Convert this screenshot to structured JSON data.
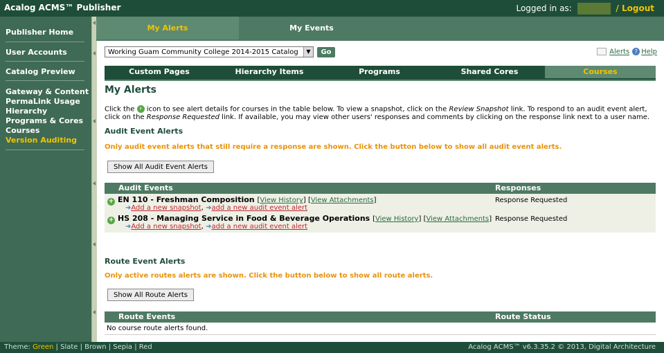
{
  "app": {
    "title": "Acalog ACMS™ Publisher",
    "logged_in_label": "Logged in as:",
    "logout_label": "/ Logout"
  },
  "sidebar": {
    "main": [
      "Publisher Home",
      "User Accounts",
      "Catalog Preview"
    ],
    "links": [
      "Gateway & Content",
      "PermaLink Usage",
      "Hierarchy",
      "Programs & Cores",
      "Courses",
      "Version Auditing"
    ],
    "active_link": "Version Auditing"
  },
  "top_tabs": [
    "My Alerts",
    "My Events"
  ],
  "catalog_select": {
    "value": "Working Guam Community College 2014-2015 Catalog",
    "go_label": "Go"
  },
  "top_links": {
    "alerts": "Alerts",
    "help": "Help"
  },
  "nav_tabs": [
    "Custom Pages",
    "Hierarchy Items",
    "Programs",
    "Shared Cores",
    "Courses"
  ],
  "page": {
    "title": "My Alerts",
    "desc": {
      "p1": "Click the ",
      "p2": " icon to see alert details for courses in the table below. To view a snapshot, click on the ",
      "p3": "Review Snapshot",
      "p4": " link. To respond to an audit event alert, click on the ",
      "p5": "Response Requested",
      "p6": " link. If available, you may view other users' responses and comments by clicking on the response link next to a user name."
    }
  },
  "audit": {
    "heading": "Audit Event Alerts",
    "notice": "Only audit event alerts that still require a response are shown. Click the button below to show all audit event alerts.",
    "button": "Show All Audit Event Alerts",
    "col_events": "Audit Events",
    "col_responses": "Responses",
    "rows": [
      {
        "course": "EN 110 - Freshman Composition",
        "view_history": "View History",
        "view_attachments": "View Attachments",
        "add_snapshot": "Add a new snapshot",
        "add_alert": "add a new audit event alert",
        "response": "Response Requested"
      },
      {
        "course": "HS 208 - Managing Service in Food & Beverage Operations",
        "view_history": "View History",
        "view_attachments": "View Attachments",
        "add_snapshot": "Add a new snapshot",
        "add_alert": "add a new audit event alert",
        "response": "Response Requested"
      }
    ]
  },
  "route": {
    "heading": "Route Event Alerts",
    "notice": "Only active routes alerts are shown. Click the button below to show all route alerts.",
    "button": "Show All Route Alerts",
    "col_events": "Route Events",
    "col_status": "Route Status",
    "empty": "No course route alerts found."
  },
  "footer": {
    "theme_label": "Theme:",
    "themes": [
      "Green",
      "Slate",
      "Brown",
      "Sepia",
      "Red"
    ],
    "right": "Acalog ACMS™ v6.3.35.2 © 2013, Digital Architecture"
  },
  "colors": {
    "dark_green": "#1e4d3a",
    "accent_yellow": "#f0c400",
    "orange_notice": "#e8920a",
    "link_red": "#c0272d"
  },
  "icons": {
    "plus": "green-plus-icon",
    "help": "help-icon",
    "alerts": "envelope-icon",
    "arrow": "arrow-right-icon"
  }
}
